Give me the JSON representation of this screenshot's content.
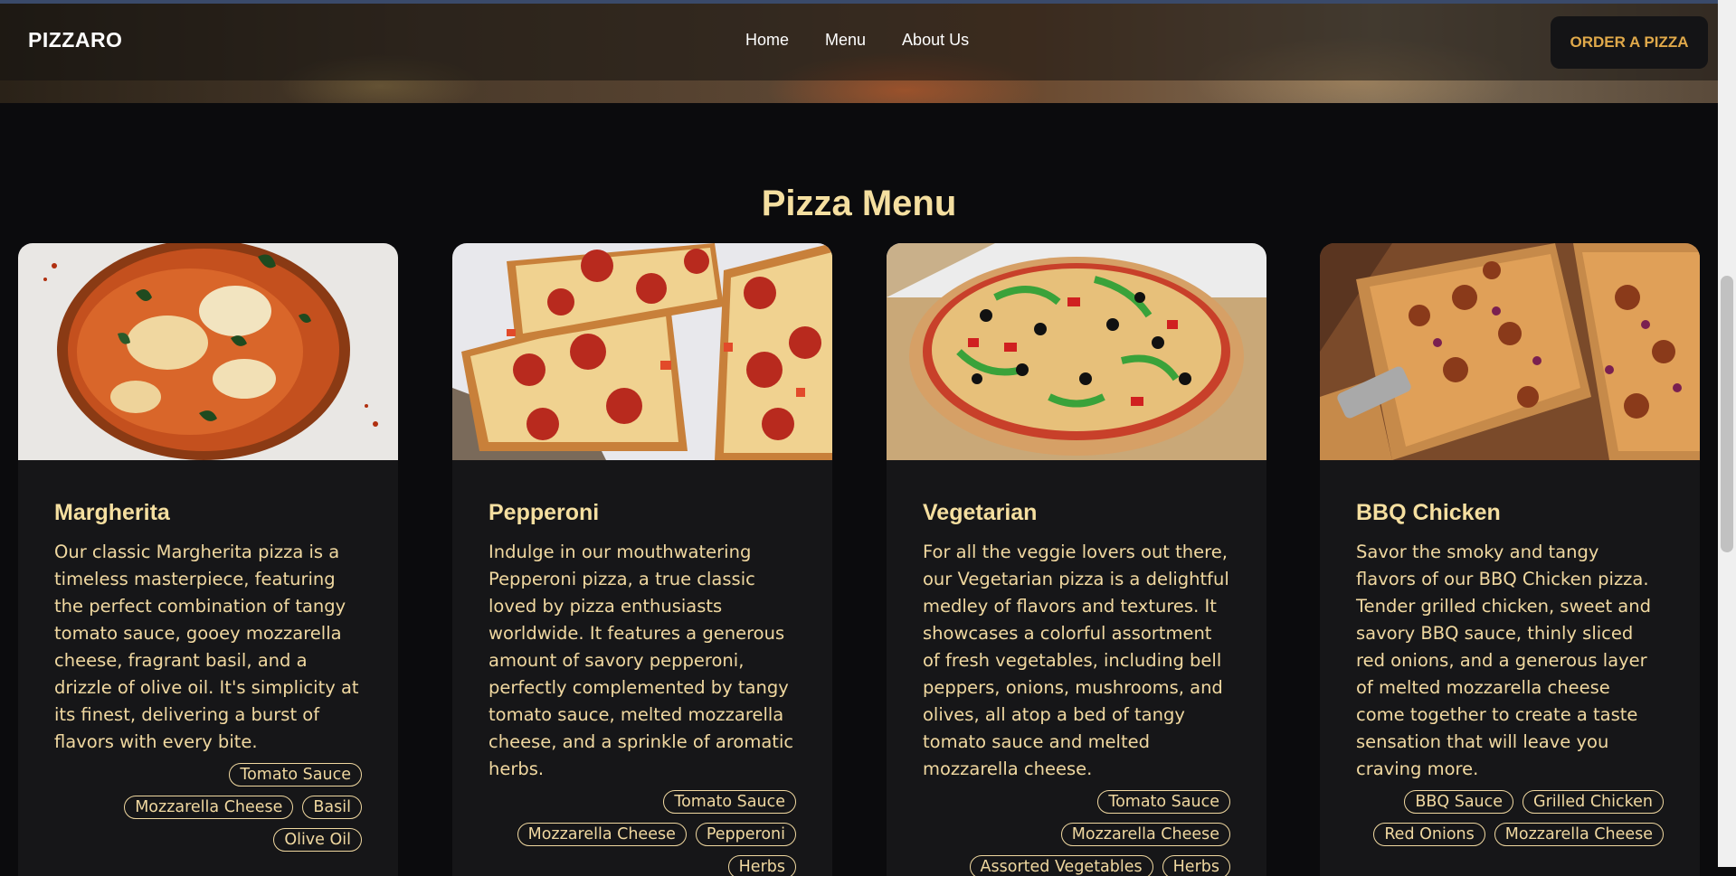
{
  "nav": {
    "brand": "PIZZARO",
    "links": [
      "Home",
      "Menu",
      "About Us"
    ],
    "cta": "ORDER A PIZZA"
  },
  "menu": {
    "title": "Pizza Menu",
    "items": [
      {
        "name": "Margherita",
        "description": "Our classic Margherita pizza is a timeless masterpiece, featuring the perfect combination of tangy tomato sauce, gooey mozzarella cheese, fragrant basil, and a drizzle of olive oil. It's simplicity at its finest, delivering a burst of flavors with every bite.",
        "tags": [
          "Tomato Sauce",
          "Mozzarella Cheese",
          "Basil",
          "Olive Oil"
        ]
      },
      {
        "name": "Pepperoni",
        "description": "Indulge in our mouthwatering Pepperoni pizza, a true classic loved by pizza enthusiasts worldwide. It features a generous amount of savory pepperoni, perfectly complemented by tangy tomato sauce, melted mozzarella cheese, and a sprinkle of aromatic herbs.",
        "tags": [
          "Tomato Sauce",
          "Mozzarella Cheese",
          "Pepperoni",
          "Herbs"
        ]
      },
      {
        "name": "Vegetarian",
        "description": "For all the veggie lovers out there, our Vegetarian pizza is a delightful medley of flavors and textures. It showcases a colorful assortment of fresh vegetables, including bell peppers, onions, mushrooms, and olives, all atop a bed of tangy tomato sauce and melted mozzarella cheese.",
        "tags": [
          "Tomato Sauce",
          "Mozzarella Cheese",
          "Assorted Vegetables",
          "Herbs"
        ]
      },
      {
        "name": "BBQ Chicken",
        "description": "Savor the smoky and tangy flavors of our BBQ Chicken pizza. Tender grilled chicken, sweet and savory BBQ sauce, thinly sliced red onions, and a generous layer of melted mozzarella cheese come together to create a taste sensation that will leave you craving more.",
        "tags": [
          "BBQ Sauce",
          "Grilled Chicken",
          "Red Onions",
          "Mozzarella Cheese"
        ]
      }
    ]
  }
}
